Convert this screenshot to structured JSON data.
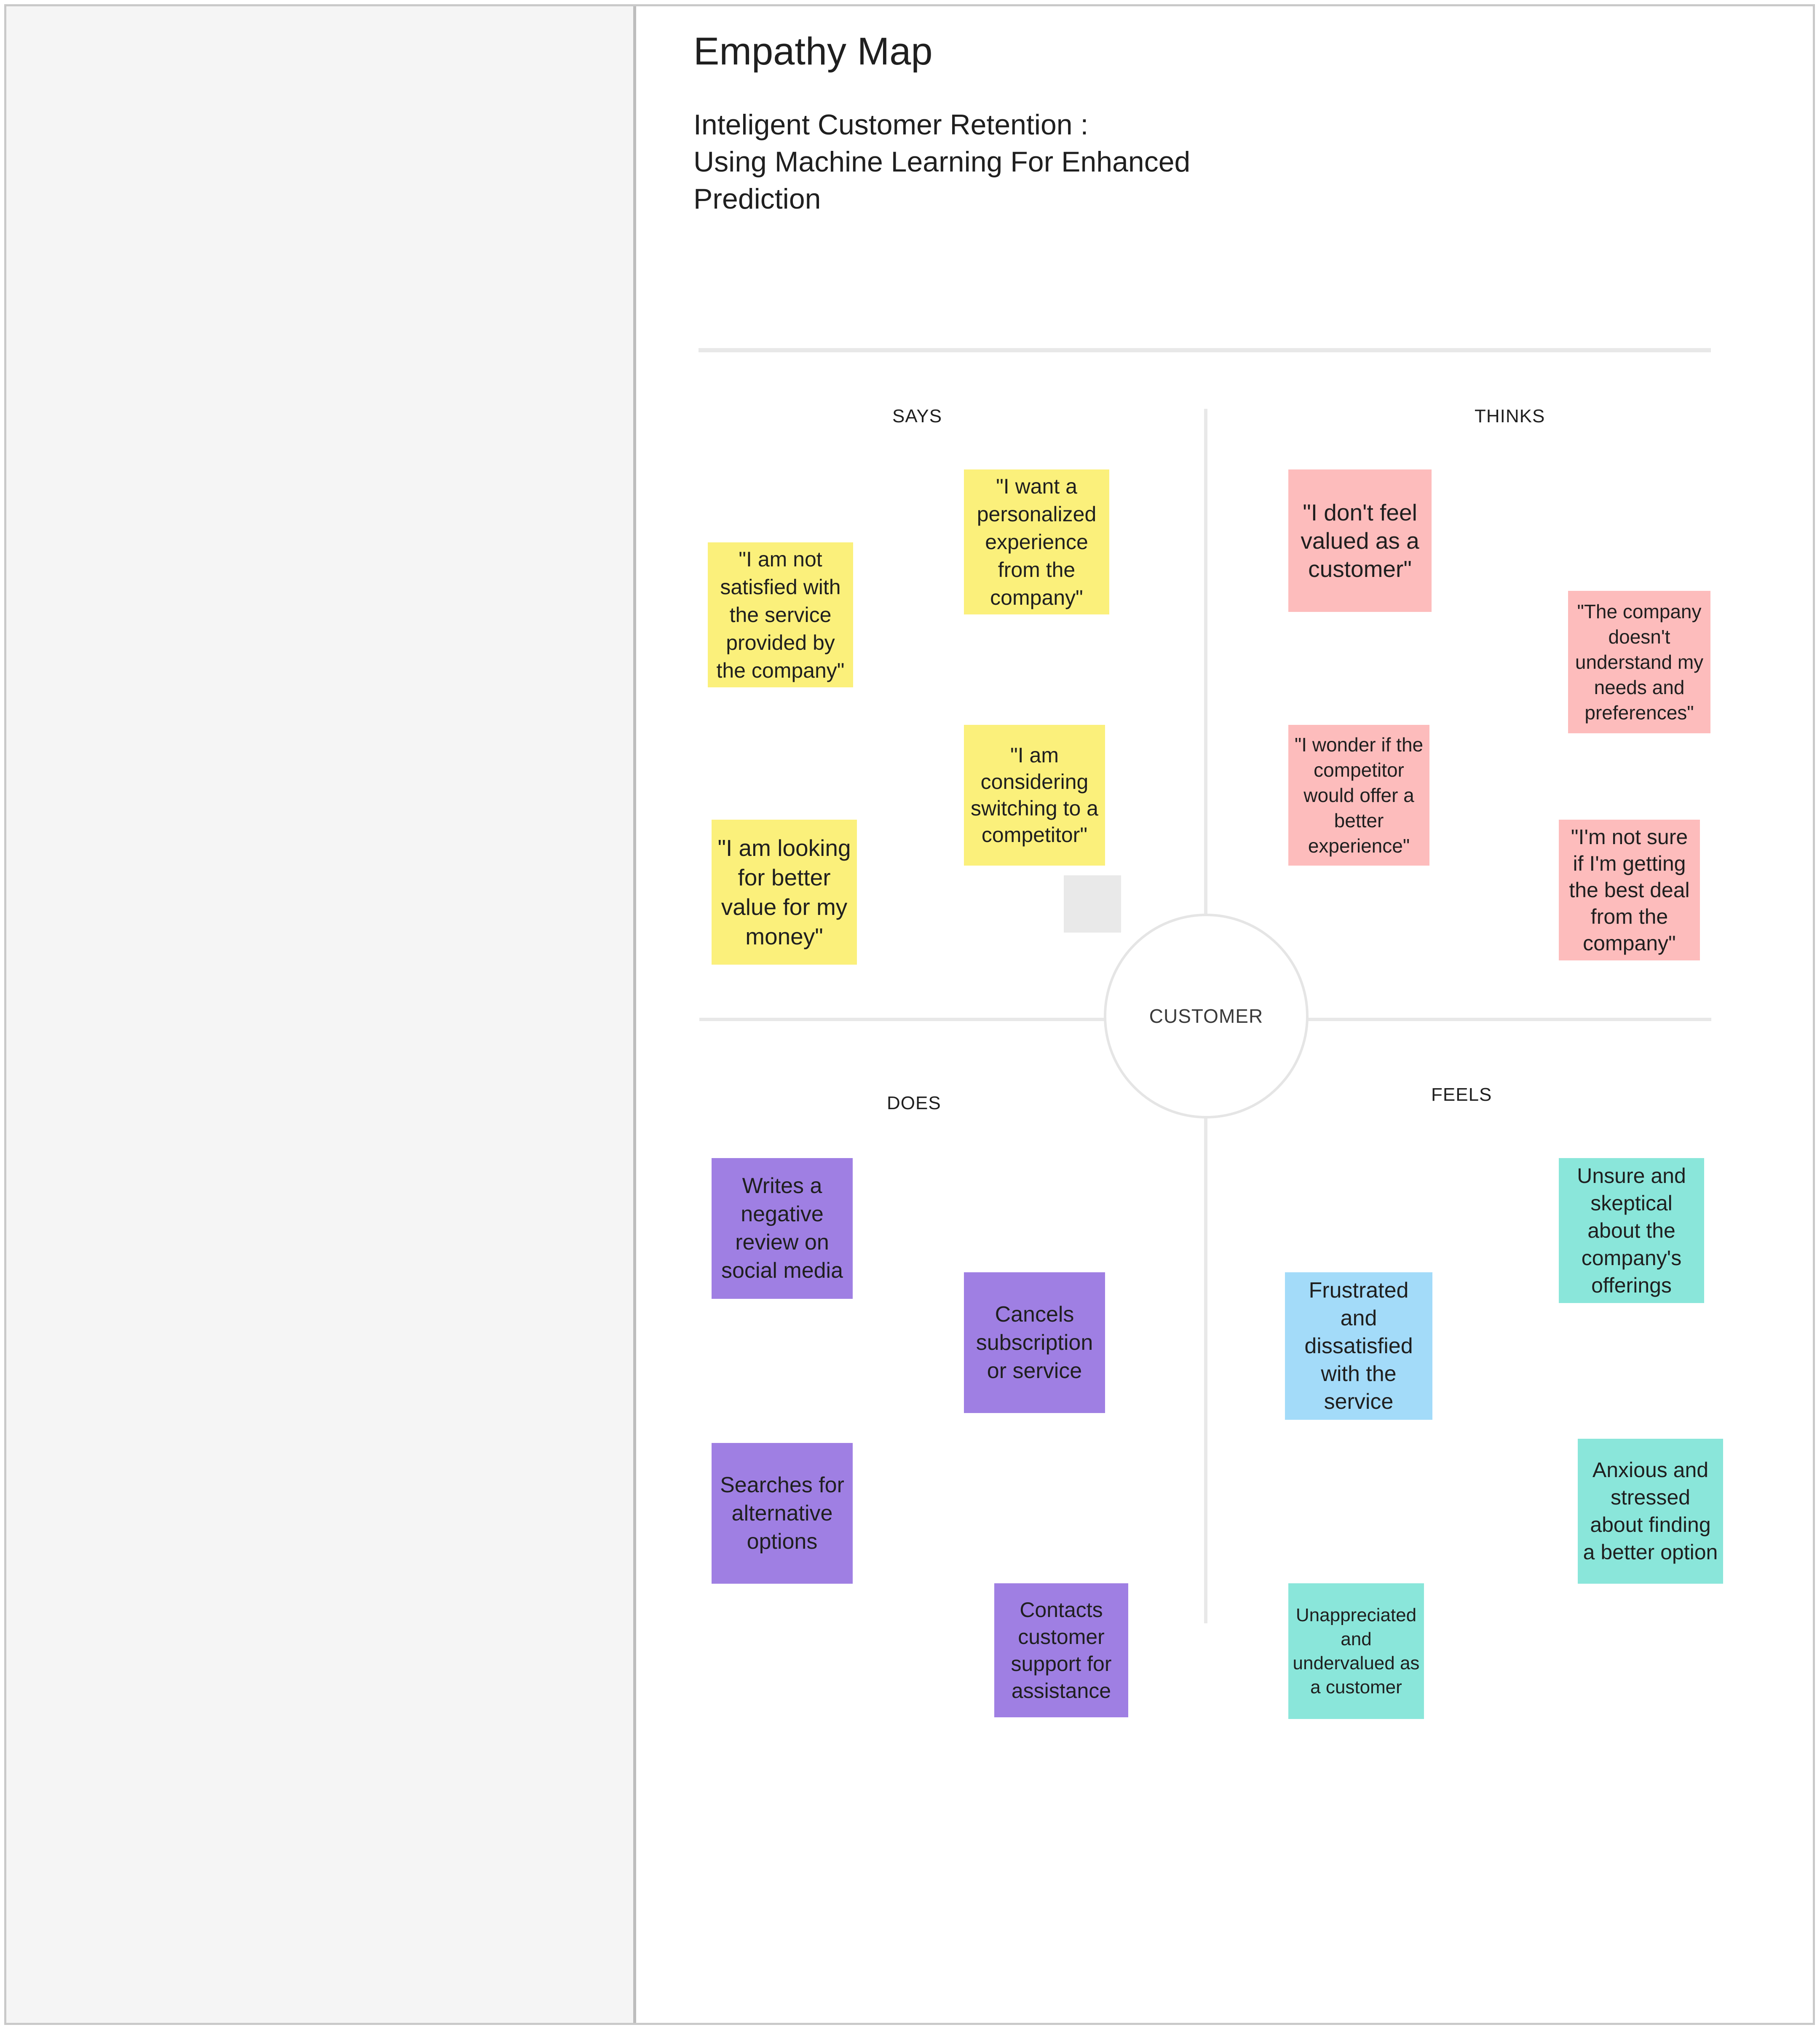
{
  "title": "Empathy Map",
  "subtitle": [
    "Inteligent Customer Retention :",
    "Using Machine Learning For Enhanced",
    "Prediction"
  ],
  "center": "CUSTOMER",
  "quadrants": {
    "says": "SAYS",
    "thinks": "THINKS",
    "does": "DOES",
    "feels": "FEELS"
  },
  "notes": {
    "says_1": "\"I am not satisfied with the service provided by the company\"",
    "says_2": "\"I want a personalized experience from the company\"",
    "says_3": "\"I am looking for better value for my money\"",
    "says_4": "\"I am considering switching to a competitor\"",
    "thinks_1": "\"I don't feel valued as a customer\"",
    "thinks_2": "\"The company doesn't understand my needs and preferences\"",
    "thinks_3": "\"I wonder if the competitor would offer a better experience\"",
    "thinks_4": "\"I'm not sure if I'm getting the best deal from the company\"",
    "does_1": "Writes a negative review on social media",
    "does_2": "Cancels subscription or service",
    "does_3": "Searches for alternative options",
    "does_4": "Contacts customer support for assistance",
    "feels_1": "Unsure and skeptical about the company's offerings",
    "feels_2": "Frustrated and dissatisfied with the service",
    "feels_3": "Anxious and stressed about finding a better option",
    "feels_4": "Unappreciated and undervalued as a customer"
  },
  "colors": {
    "says": "#fbf07b",
    "thinks": "#fdbcbc",
    "does": "#9f7fe3",
    "feels_blue": "#a3dbf9",
    "feels_teal": "#8ae6da"
  }
}
